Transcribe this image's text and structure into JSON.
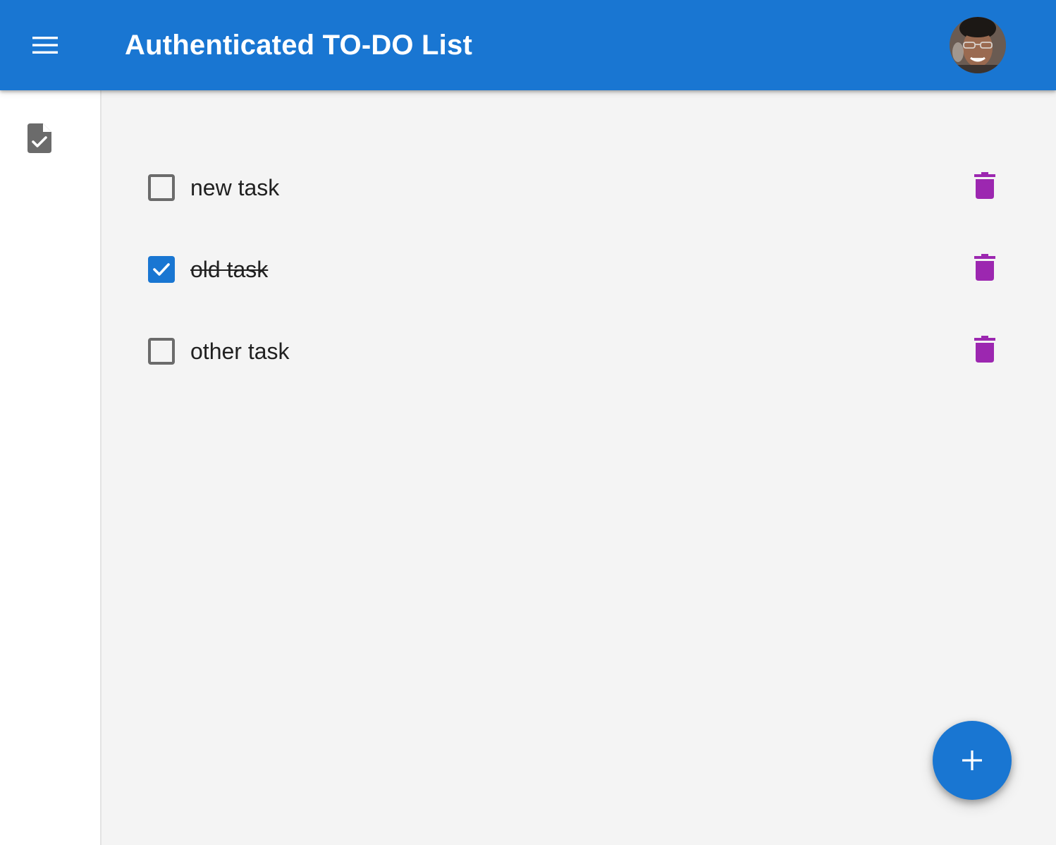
{
  "appbar": {
    "title": "Authenticated TO-DO List",
    "color": "#1976d2",
    "menu_icon": "menu-icon",
    "avatar": "user-avatar"
  },
  "sidebar": {
    "items": [
      {
        "icon": "task-file-icon"
      }
    ]
  },
  "tasks": [
    {
      "label": "new task",
      "done": false
    },
    {
      "label": "old task",
      "done": true
    },
    {
      "label": "other task",
      "done": false
    }
  ],
  "colors": {
    "primary": "#1976d2",
    "delete": "#9c27b0",
    "background": "#f4f4f4"
  },
  "fab": {
    "icon": "plus-icon"
  }
}
